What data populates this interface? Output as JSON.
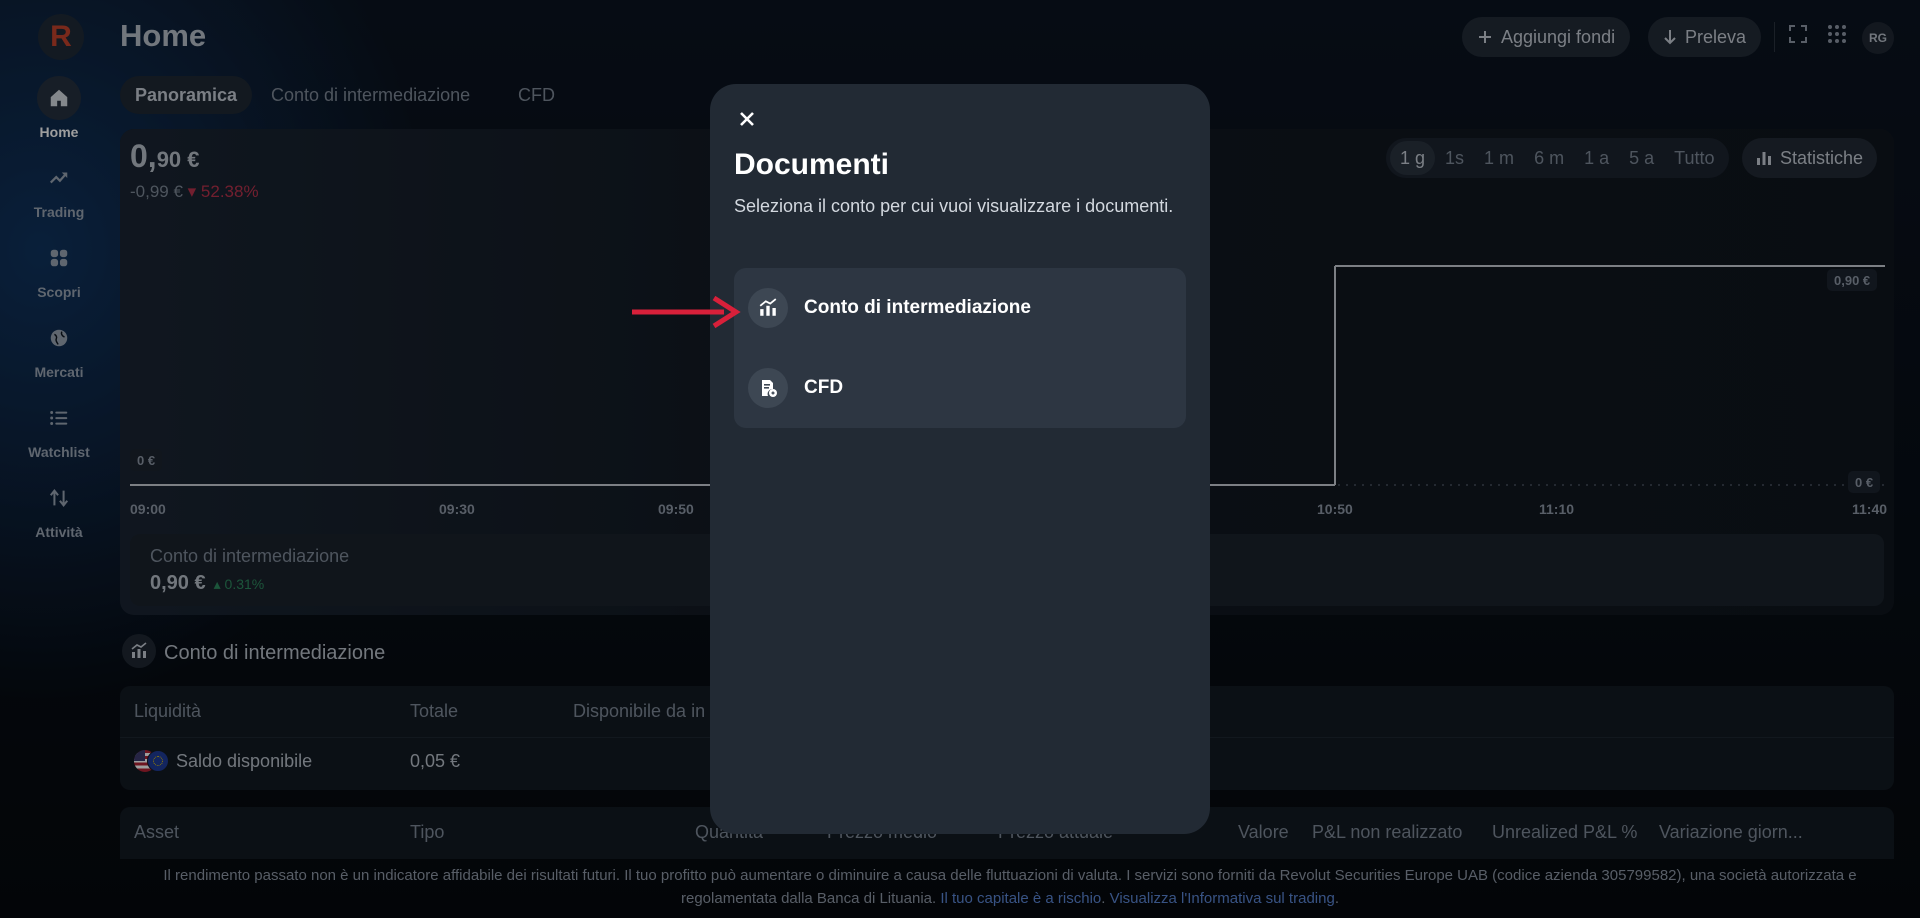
{
  "nav": {
    "logo_letter": "R",
    "items": [
      {
        "label": "Home",
        "icon": "home-icon"
      },
      {
        "label": "Trading",
        "icon": "trending-up-icon"
      },
      {
        "label": "Scopri",
        "icon": "grid-icon"
      },
      {
        "label": "Mercati",
        "icon": "globe-icon"
      },
      {
        "label": "Watchlist",
        "icon": "list-icon"
      },
      {
        "label": "Attività",
        "icon": "swap-vertical-icon"
      }
    ]
  },
  "header": {
    "title": "Home",
    "add_funds": "Aggiungi fondi",
    "withdraw": "Preleva",
    "avatar": "RG"
  },
  "tabs": [
    "Panoramica",
    "Conto di intermediazione",
    "CFD"
  ],
  "chart": {
    "value_int": "0,",
    "value_dec": "90 €",
    "change_abs": "-0,99 €",
    "change_pct": "▾ 52.38%",
    "ranges": [
      "1 g",
      "1s",
      "1 m",
      "6 m",
      "1 a",
      "5 a",
      "Tutto"
    ],
    "selected_range": "1 g",
    "stats_label": "Statistiche",
    "tag_current": "0,90 €",
    "tag_zero_left": "0 €",
    "tag_zero_right": "0 €",
    "x_ticks": [
      "09:00",
      "09:30",
      "09:50",
      "10:50",
      "11:10",
      "11:40"
    ]
  },
  "chart_data": {
    "type": "line",
    "x": [
      "09:00",
      "09:30",
      "09:50",
      "10:50",
      "11:10",
      "11:40"
    ],
    "series": [
      {
        "values": [
          0,
          0,
          0,
          0.9,
          0.9,
          0.9
        ]
      }
    ],
    "ylabels": [
      "0,90 €",
      "0 €"
    ]
  },
  "account_card": {
    "name": "Conto di intermediazione",
    "value": "0,90 €",
    "pct": "▴ 0.31%"
  },
  "section": {
    "title": "Conto di intermediazione"
  },
  "cash_table": {
    "headers": [
      "Liquidità",
      "Totale",
      "Disponibile da in"
    ],
    "row": {
      "name": "Saldo disponibile",
      "total": "0,05 €"
    }
  },
  "assets_table": {
    "headers": [
      "Asset",
      "Tipo",
      "Quantità",
      "Prezzo medio",
      "Prezzo attuale",
      "Valore",
      "P&L non realizzato",
      "Unrealized P&L %",
      "Variazione giorn..."
    ]
  },
  "footer": {
    "text": "Il rendimento passato non è un indicatore affidabile dei risultati futuri. Il tuo profitto può aumentare o diminuire a causa delle fluttuazioni di valuta. I servizi sono forniti da Revolut Securities Europe UAB (codice azienda 305799582), una società autorizzata e regolamentata dalla Banca di Lituania. ",
    "link1": "Il tuo capitale è a rischio",
    "link2": "Visualizza l'Informativa sul trading",
    "sep": ". ",
    "end": "."
  },
  "modal": {
    "title": "Documenti",
    "subtitle": "Seleziona il conto per cui vuoi visualizzare i documenti.",
    "options": [
      {
        "label": "Conto di intermediazione",
        "icon": "brokerage-chart-icon"
      },
      {
        "label": "CFD",
        "icon": "cfd-document-icon"
      }
    ]
  },
  "colors": {
    "accent_red": "#d8203a",
    "negative": "#b8324c",
    "positive": "#2e8a5f",
    "link": "#5b86d6"
  }
}
